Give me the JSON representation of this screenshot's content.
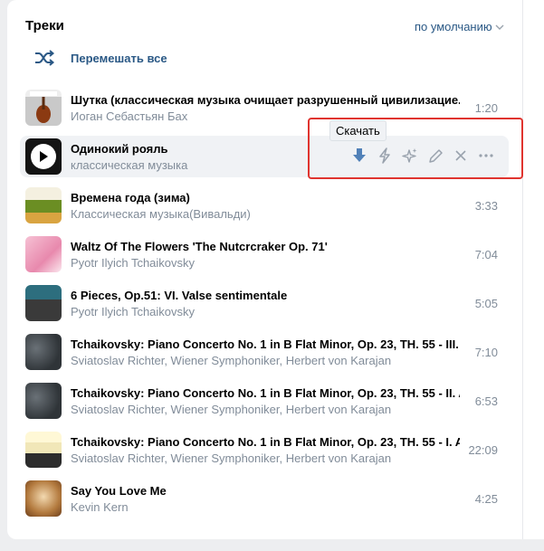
{
  "header": {
    "title": "Треки",
    "sort_label": "по умолчанию"
  },
  "shuffle": {
    "label": "Перемешать все"
  },
  "tooltip": "Скачать",
  "colors": {
    "accent": "#2a5885",
    "highlight": "#e0342f",
    "secondary_text": "#818c99"
  },
  "tracks": [
    {
      "title": "Шутка (классическая музыка очищает разрушенный цивилизацие...",
      "artist": "Иоган Себастьян Бах",
      "duration": "1:20"
    },
    {
      "title": "Одинокий рояль",
      "artist": "классическая музыка",
      "duration": ""
    },
    {
      "title": "Времена года (зима)",
      "artist": "Классическая музыка(Вивальди)",
      "duration": "3:33"
    },
    {
      "title": "Waltz Of The Flowers 'The Nutcrcraker Op. 71'",
      "artist": "Pyotr Ilyich Tchaikovsky",
      "duration": "7:04"
    },
    {
      "title": "6 Pieces, Op.51: VI. Valse sentimentale",
      "artist": "Pyotr Ilyich Tchaikovsky",
      "duration": "5:05"
    },
    {
      "title": "Tchaikovsky: Piano Concerto No. 1 in B Flat Minor, Op. 23, TH. 55 - III. A...",
      "artist": "Sviatoslav Richter, Wiener Symphoniker, Herbert von Karajan",
      "duration": "7:10"
    },
    {
      "title": "Tchaikovsky: Piano Concerto No. 1 in B Flat Minor, Op. 23, TH. 55 - II. A...",
      "artist": "Sviatoslav Richter, Wiener Symphoniker, Herbert von Karajan",
      "duration": "6:53"
    },
    {
      "title": "Tchaikovsky: Piano Concerto No. 1 in B Flat Minor, Op. 23, TH. 55 - I. A...",
      "artist": "Sviatoslav Richter, Wiener Symphoniker, Herbert von Karajan",
      "duration": "22:09"
    },
    {
      "title": "Say You Love Me",
      "artist": "Kevin Kern",
      "duration": "4:25"
    }
  ],
  "action_icons": [
    "download-icon",
    "lightning-icon",
    "sparkle-icon",
    "pencil-icon",
    "close-icon",
    "more-icon"
  ]
}
